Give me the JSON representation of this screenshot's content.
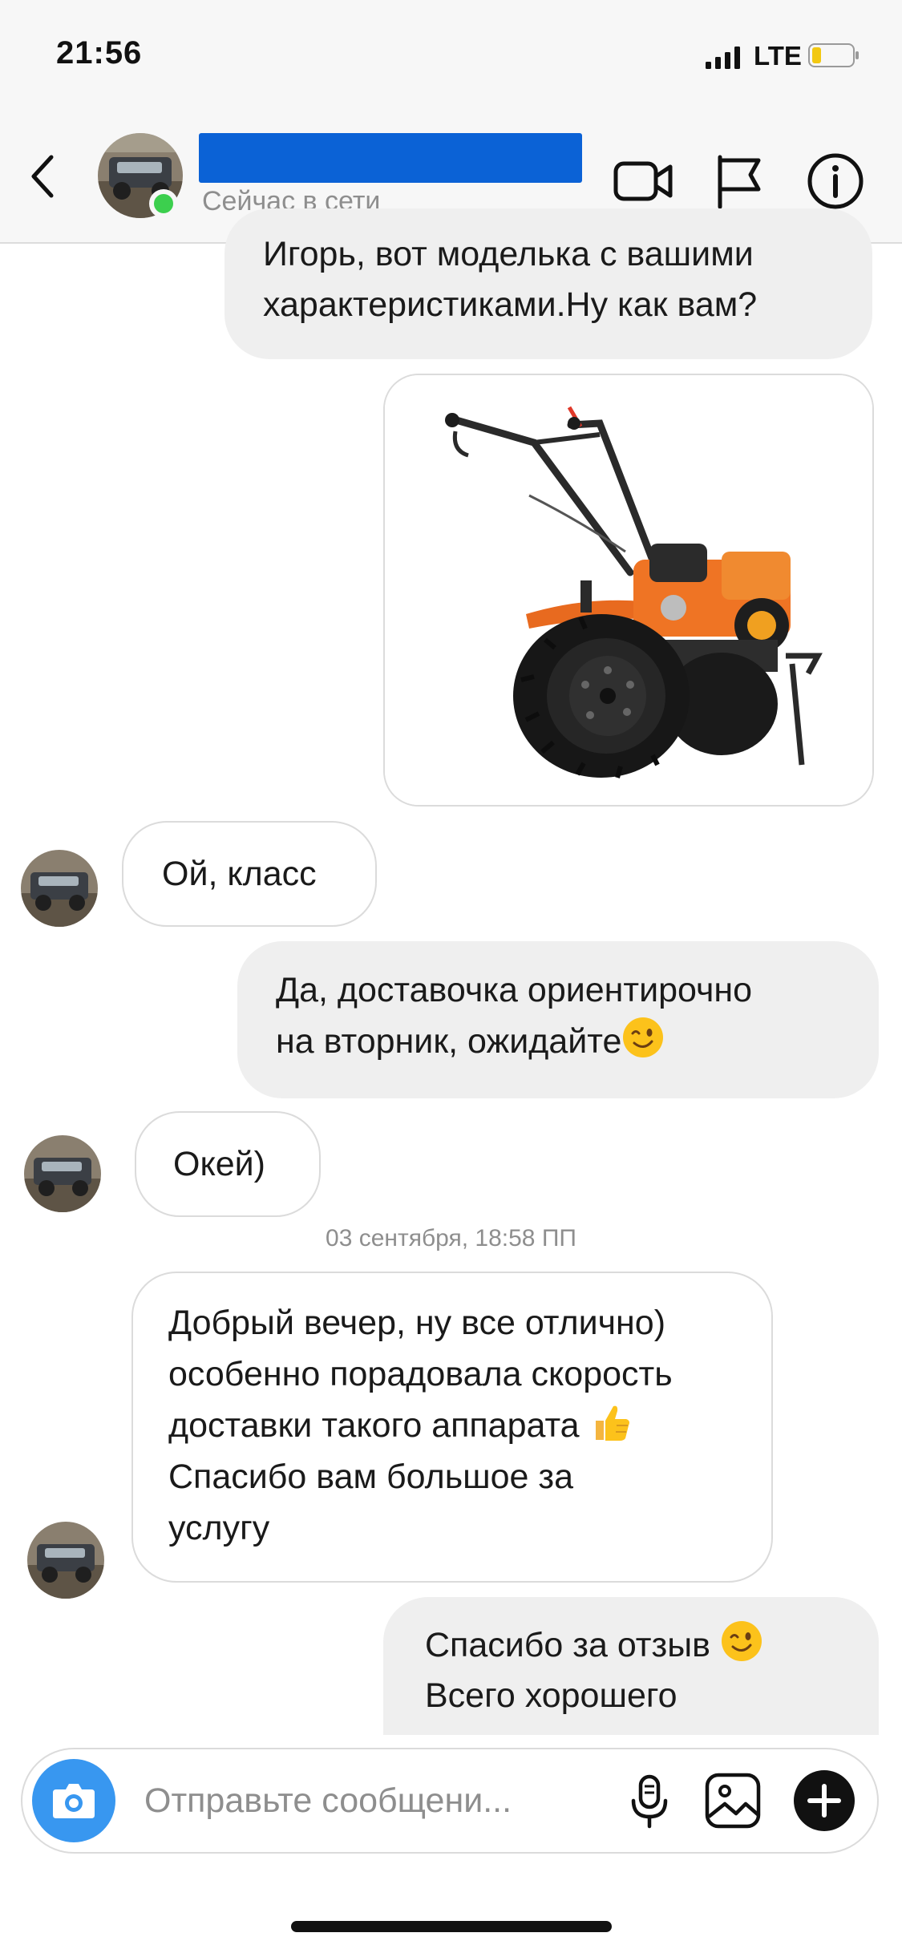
{
  "status_bar": {
    "time": "21:56",
    "network": "LTE",
    "icons": [
      "signal-bars-icon",
      "battery-low-icon"
    ]
  },
  "header": {
    "back_icon": "chevron-left-icon",
    "presence": "Сейчас в сети",
    "actions": [
      "video-call-icon",
      "flag-icon",
      "info-icon"
    ]
  },
  "messages": [
    {
      "direction": "outgoing",
      "lines": [
        "Игорь, вот моделька с вашими",
        "характеристиками.Ну как вам?"
      ]
    },
    {
      "direction": "outgoing",
      "type": "image",
      "content": "motoblock-photo"
    },
    {
      "direction": "incoming",
      "text": "Ой, класс"
    },
    {
      "direction": "outgoing",
      "lines": [
        "Да, доставочка ориентирочно",
        "на вторник, ожидайте"
      ],
      "emoji": "winking-face"
    },
    {
      "direction": "incoming",
      "text": "Окей)"
    },
    {
      "direction": "incoming",
      "lines": [
        "Добрый вечер, ну все отлично)",
        "особенно порадовала скорость",
        "доставки такого аппарата",
        "Спасибо вам большое за",
        "услугу"
      ],
      "emoji": "thumbs-up"
    },
    {
      "direction": "outgoing",
      "lines": [
        "Спасибо за отзыв",
        "Всего хорошего"
      ],
      "emoji": "winking-face"
    }
  ],
  "timestamp": "03 сентября, 18:58 ПП",
  "composer": {
    "placeholder": "Отправьте сообщени...",
    "icons": [
      "camera-icon",
      "microphone-icon",
      "gallery-icon",
      "plus-icon"
    ]
  },
  "colors": {
    "online": "#3ccf4e",
    "camera_button": "#3897f0",
    "name_redaction": "#0b62d6",
    "outgoing_bubble": "#efefef"
  }
}
